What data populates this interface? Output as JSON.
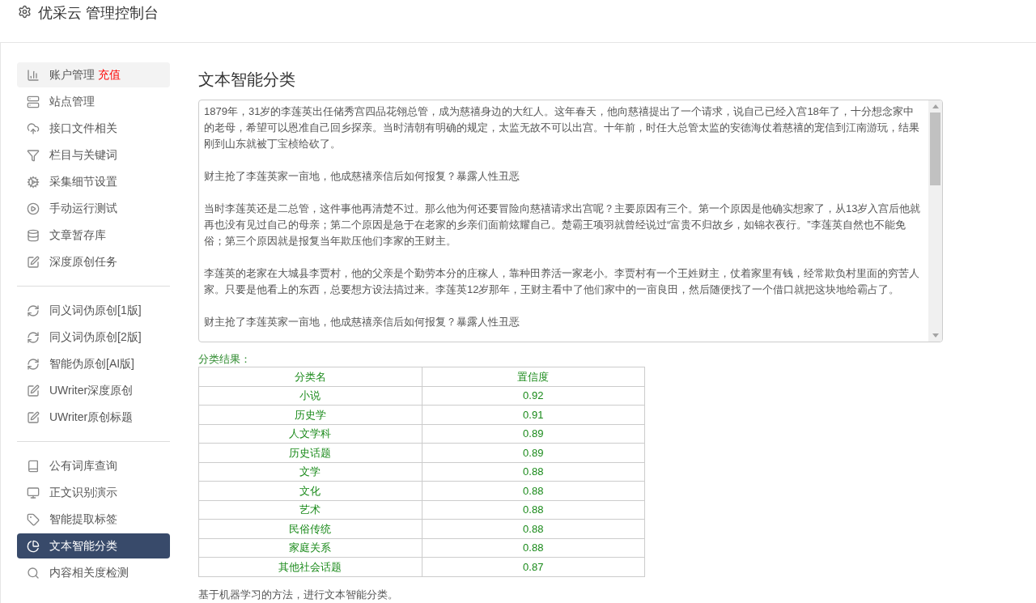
{
  "header": {
    "title": "优采云 管理控制台"
  },
  "sidebar": {
    "groups": [
      {
        "items": [
          {
            "label": "账户管理",
            "badge": "充值",
            "highlighted": true,
            "selected": false
          },
          {
            "label": "站点管理",
            "highlighted": false,
            "selected": false
          },
          {
            "label": "接口文件相关",
            "highlighted": false,
            "selected": false
          },
          {
            "label": "栏目与关键词",
            "highlighted": false,
            "selected": false
          },
          {
            "label": "采集细节设置",
            "highlighted": false,
            "selected": false
          },
          {
            "label": "手动运行测试",
            "highlighted": false,
            "selected": false
          },
          {
            "label": "文章暂存库",
            "highlighted": false,
            "selected": false
          },
          {
            "label": "深度原创任务",
            "highlighted": false,
            "selected": false
          }
        ]
      },
      {
        "items": [
          {
            "label": "同义词伪原创[1版]",
            "highlighted": false,
            "selected": false
          },
          {
            "label": "同义词伪原创[2版]",
            "highlighted": false,
            "selected": false
          },
          {
            "label": "智能伪原创[AI版]",
            "highlighted": false,
            "selected": false
          },
          {
            "label": "UWriter深度原创",
            "highlighted": false,
            "selected": false
          },
          {
            "label": "UWriter原创标题",
            "highlighted": false,
            "selected": false
          }
        ]
      },
      {
        "items": [
          {
            "label": "公有词库查询",
            "highlighted": false,
            "selected": false
          },
          {
            "label": "正文识别演示",
            "highlighted": false,
            "selected": false
          },
          {
            "label": "智能提取标签",
            "highlighted": false,
            "selected": false
          },
          {
            "label": "文本智能分类",
            "highlighted": false,
            "selected": true
          },
          {
            "label": "内容相关度检测",
            "highlighted": false,
            "selected": false
          }
        ]
      }
    ]
  },
  "main": {
    "title": "文本智能分类",
    "input_text": {
      "paragraphs": [
        "1879年，31岁的李莲英出任储秀宫四品花翎总管，成为慈禧身边的大红人。这年春天，他向慈禧提出了一个请求，说自己已经入宫18年了，十分想念家中的老母，希望可以恩准自己回乡探亲。当时清朝有明确的规定，太监无故不可以出宫。十年前，时任大总管太监的安德海仗着慈禧的宠信到江南游玩，结果刚到山东就被丁宝桢给砍了。",
        "财主抢了李莲英家一亩地，他成慈禧亲信后如何报复？暴露人性丑恶",
        "当时李莲英还是二总管，这件事他再清楚不过。那么他为何还要冒险向慈禧请求出宫呢？主要原因有三个。第一个原因是他确实想家了，从13岁入宫后他就再也没有见过自己的母亲；第二个原因是急于在老家的乡亲们面前炫耀自己。楚霸王项羽就曾经说过“富贵不归故乡，如锦衣夜行。”李莲英自然也不能免俗；第三个原因就是报复当年欺压他们李家的王财主。",
        "李莲英的老家在大城县李贾村，他的父亲是个勤劳本分的庄稼人，靠种田养活一家老小。李贾村有一个王姓财主，仗着家里有钱，经常欺负村里面的穷苦人家。只要是他看上的东西，总要想方设法搞过来。李莲英12岁那年，王财主看中了他们家中的一亩良田，然后随便找了一个借口就把这块地给霸占了。",
        "财主抢了李莲英家一亩地，他成慈禧亲信后如何报复？暴露人性丑恶"
      ]
    },
    "result_label": "分类结果：",
    "table": {
      "columns": [
        "分类名",
        "置信度"
      ],
      "rows": [
        [
          "小说",
          "0.92"
        ],
        [
          "历史学",
          "0.91"
        ],
        [
          "人文学科",
          "0.89"
        ],
        [
          "历史话题",
          "0.89"
        ],
        [
          "文学",
          "0.88"
        ],
        [
          "文化",
          "0.88"
        ],
        [
          "艺术",
          "0.88"
        ],
        [
          "民俗传统",
          "0.88"
        ],
        [
          "家庭关系",
          "0.88"
        ],
        [
          "其他社会话题",
          "0.87"
        ]
      ]
    },
    "footnote": "基于机器学习的方法，进行文本智能分类。"
  }
}
